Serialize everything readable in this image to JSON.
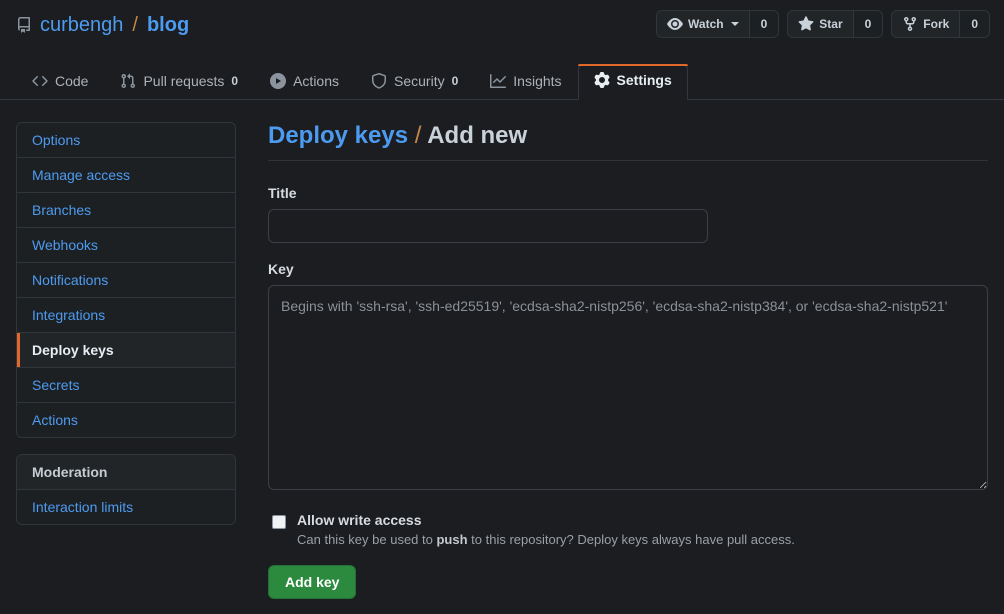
{
  "repo": {
    "icon": "repo-icon",
    "owner": "curbengh",
    "separator": "/",
    "name": "blog"
  },
  "repo_actions": [
    {
      "icon": "eye-icon",
      "label": "Watch",
      "has_caret": true,
      "count": "0"
    },
    {
      "icon": "star-icon",
      "label": "Star",
      "has_caret": false,
      "count": "0"
    },
    {
      "icon": "fork-icon",
      "label": "Fork",
      "has_caret": false,
      "count": "0"
    }
  ],
  "tabs": [
    {
      "icon": "code-icon",
      "label": "Code",
      "count": "",
      "selected": false
    },
    {
      "icon": "pull-request-icon",
      "label": "Pull requests",
      "count": "0",
      "selected": false
    },
    {
      "icon": "play-icon",
      "label": "Actions",
      "count": "",
      "selected": false
    },
    {
      "icon": "shield-icon",
      "label": "Security",
      "count": "0",
      "selected": false
    },
    {
      "icon": "graph-icon",
      "label": "Insights",
      "count": "",
      "selected": false
    },
    {
      "icon": "gear-icon",
      "label": "Settings",
      "count": "",
      "selected": true
    }
  ],
  "sidebar": {
    "groups": [
      {
        "heading": null,
        "items": [
          {
            "label": "Options",
            "selected": false
          },
          {
            "label": "Manage access",
            "selected": false
          },
          {
            "label": "Branches",
            "selected": false
          },
          {
            "label": "Webhooks",
            "selected": false
          },
          {
            "label": "Notifications",
            "selected": false
          },
          {
            "label": "Integrations",
            "selected": false
          },
          {
            "label": "Deploy keys",
            "selected": true
          },
          {
            "label": "Secrets",
            "selected": false
          },
          {
            "label": "Actions",
            "selected": false
          }
        ]
      },
      {
        "heading": "Moderation",
        "items": [
          {
            "label": "Interaction limits",
            "selected": false
          }
        ]
      }
    ]
  },
  "main": {
    "title_link": "Deploy keys",
    "title_sep": "/",
    "title_current": "Add new",
    "title_field": {
      "label": "Title",
      "value": "",
      "placeholder": ""
    },
    "key_field": {
      "label": "Key",
      "value": "",
      "placeholder": "Begins with 'ssh-rsa', 'ssh-ed25519', 'ecdsa-sha2-nistp256', 'ecdsa-sha2-nistp384', or 'ecdsa-sha2-nistp521'"
    },
    "allow_write": {
      "label": "Allow write access",
      "checked": false,
      "note_before": "Can this key be used to ",
      "note_bold": "push",
      "note_after": " to this repository? Deploy keys always have pull access."
    },
    "submit_label": "Add key"
  },
  "colors": {
    "background": "#1b1d20",
    "accent_orange": "#e2672b",
    "link_blue": "#4d9bf0",
    "button_green": "#2b8a3e",
    "border": "#31363b"
  }
}
